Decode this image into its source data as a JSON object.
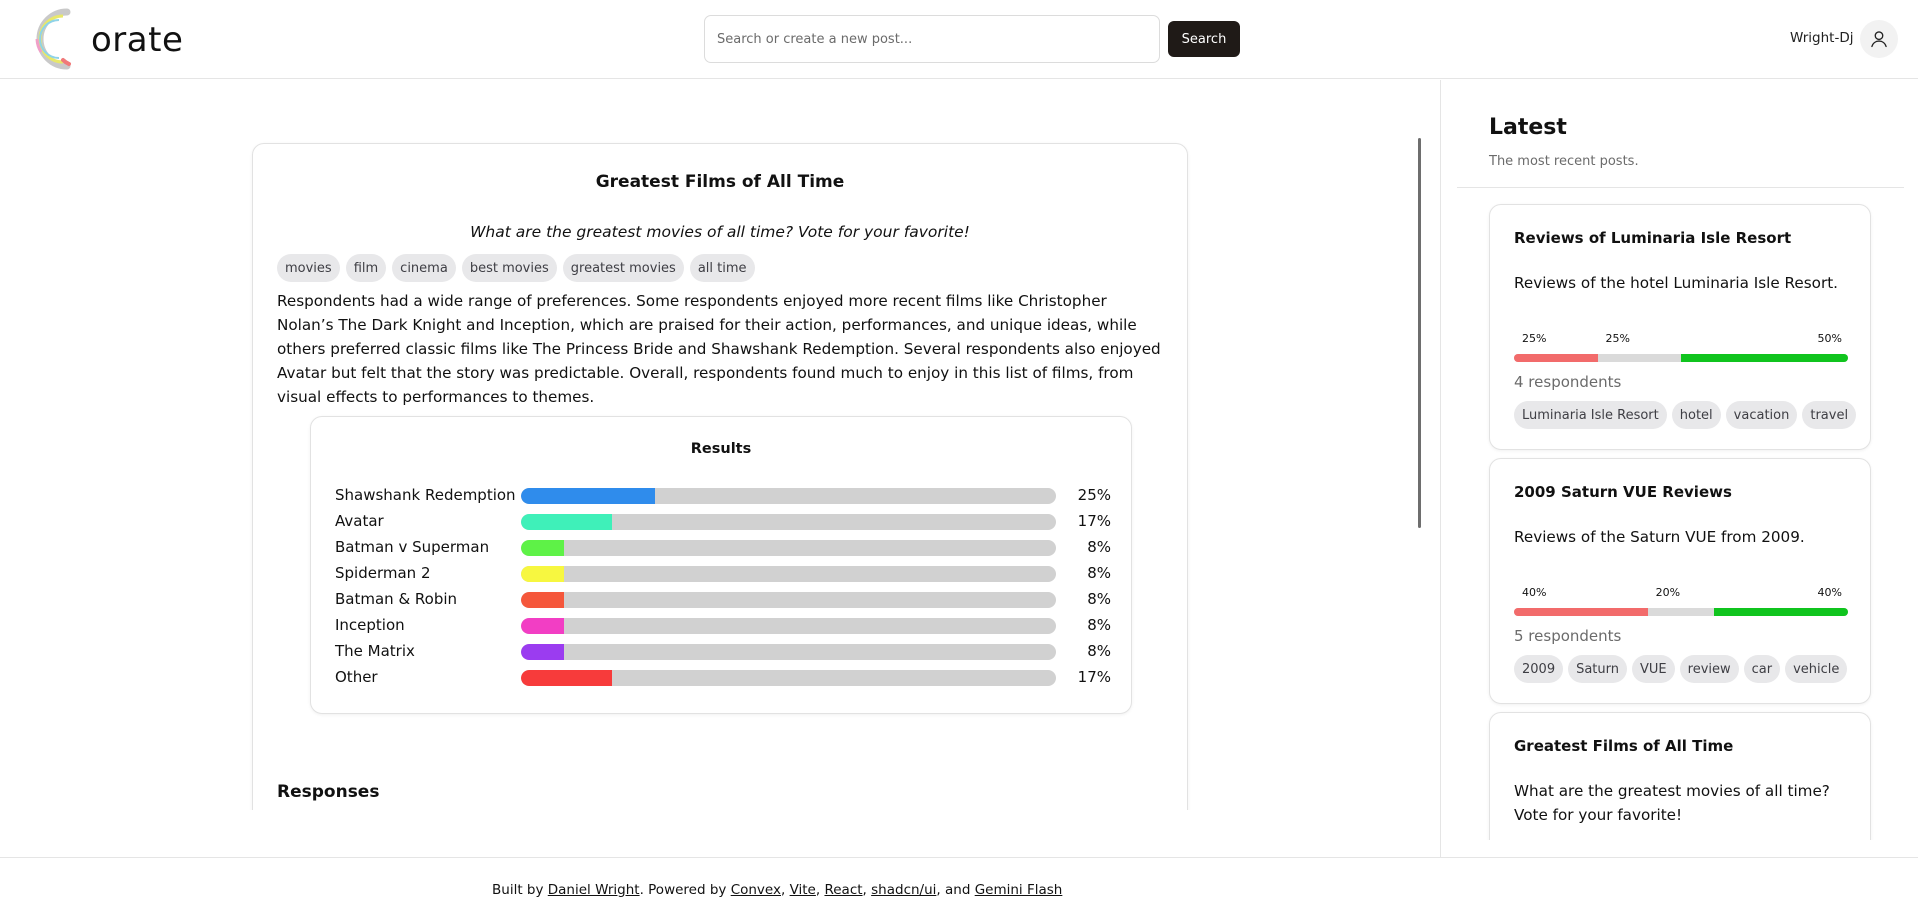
{
  "header": {
    "logo_text": "orate",
    "search_placeholder": "Search or create a new post...",
    "search_button": "Search",
    "username": "Wright-Dj"
  },
  "post": {
    "title": "Greatest Films of All Time",
    "question": "What are the greatest movies of all time? Vote for your favorite!",
    "tags": [
      "movies",
      "film",
      "cinema",
      "best movies",
      "greatest movies",
      "all time"
    ],
    "summary": "Respondents had a wide range of preferences. Some respondents enjoyed more recent films like Christopher Nolan’s The Dark Knight and Inception, which are praised for their action, performances, and unique ideas, while others preferred classic films like The Princess Bride and Shawshank Redemption. Several respondents also enjoyed Avatar but felt that the story was predictable. Overall, respondents found much to enjoy in this list of films, from visual effects to performances to themes.",
    "results_title": "Results",
    "results": [
      {
        "label": "Shawshank Redemption",
        "pct": "25%",
        "value": 25,
        "color": "#2f8cec"
      },
      {
        "label": "Avatar",
        "pct": "17%",
        "value": 17,
        "color": "#3ff0b9"
      },
      {
        "label": "Batman v Superman",
        "pct": "8%",
        "value": 8,
        "color": "#5ef247"
      },
      {
        "label": "Spiderman 2",
        "pct": "8%",
        "value": 8,
        "color": "#f7f740"
      },
      {
        "label": "Batman & Robin",
        "pct": "8%",
        "value": 8,
        "color": "#f5573b"
      },
      {
        "label": "Inception",
        "pct": "8%",
        "value": 8,
        "color": "#f23ec4"
      },
      {
        "label": "The Matrix",
        "pct": "8%",
        "value": 8,
        "color": "#9b3cf0"
      },
      {
        "label": "Other",
        "pct": "17%",
        "value": 17,
        "color": "#f73b3b"
      }
    ],
    "responses_heading": "Responses"
  },
  "sidebar": {
    "title": "Latest",
    "subtitle": "The most recent posts.",
    "cards": [
      {
        "title": "Reviews of Luminaria Isle Resort",
        "description": "Reviews of the hotel Luminaria Isle Resort.",
        "dist": [
          {
            "label": "25%",
            "value": 25,
            "color": "#f26b6b"
          },
          {
            "label": "25%",
            "value": 25,
            "color": "#dadada"
          },
          {
            "label": "50%",
            "value": 50,
            "color": "#10c41e"
          }
        ],
        "respondents": "4 respondents",
        "tags": [
          "Luminaria Isle Resort",
          "hotel",
          "vacation",
          "travel"
        ]
      },
      {
        "title": "2009 Saturn VUE Reviews",
        "description": "Reviews of the Saturn VUE from 2009.",
        "dist": [
          {
            "label": "40%",
            "value": 40,
            "color": "#f26b6b"
          },
          {
            "label": "20%",
            "value": 20,
            "color": "#dadada"
          },
          {
            "label": "40%",
            "value": 40,
            "color": "#10c41e"
          }
        ],
        "respondents": "5 respondents",
        "tags": [
          "2009",
          "Saturn",
          "VUE",
          "review",
          "car",
          "vehicle"
        ]
      },
      {
        "title": "Greatest Films of All Time",
        "description": "What are the greatest movies of all time? Vote for your favorite!"
      }
    ]
  },
  "footer": {
    "built_by": "Built by ",
    "author": "Daniel Wright",
    "powered_by": ". Powered by ",
    "links": [
      "Convex",
      "Vite",
      "React",
      "shadcn/ui"
    ],
    "and": ", and ",
    "last_link": "Gemini Flash"
  }
}
